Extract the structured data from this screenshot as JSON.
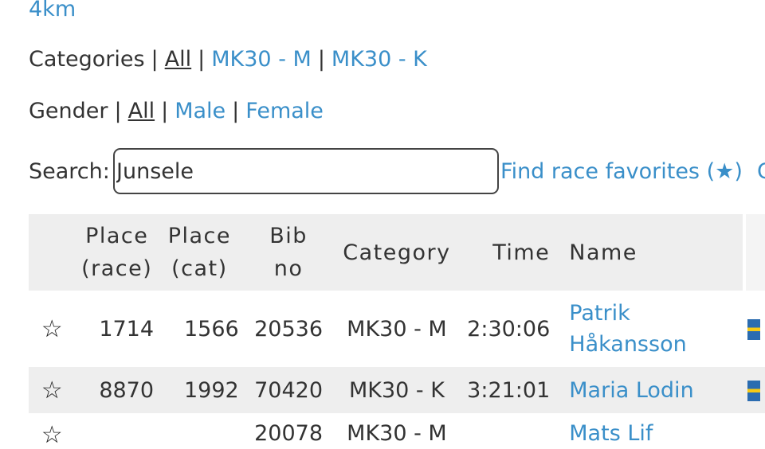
{
  "distance_label": "4km",
  "filters": {
    "categories": {
      "label": "Categories",
      "sep": "|",
      "options": [
        "All",
        "MK30 - M",
        "MK30 - K"
      ]
    },
    "gender": {
      "label": "Gender",
      "sep": "|",
      "options": [
        "All",
        "Male",
        "Female"
      ]
    }
  },
  "search": {
    "label": "Search:",
    "value": "Junsele",
    "favorites_link": "Find race favorites (★)",
    "next_link_partial": "C"
  },
  "table": {
    "columns": [
      "",
      "Place (race)",
      "Place (cat)",
      "Bib no",
      "Category",
      "Time",
      "Name",
      ""
    ],
    "header_lines": {
      "place_race": [
        "Place",
        "(race)"
      ],
      "place_cat": [
        "Place",
        "(cat)"
      ],
      "bib": [
        "Bib",
        "no"
      ],
      "category": "Category",
      "time": "Time",
      "name": "Name"
    },
    "rows": [
      {
        "star": "☆",
        "place_race": "1714",
        "place_cat": "1566",
        "bib": "20536",
        "category": "MK30 - M",
        "time": "2:30:06",
        "name": "Patrik Håkansson",
        "flag": "swedish-flag-icon"
      },
      {
        "star": "☆",
        "place_race": "8870",
        "place_cat": "1992",
        "bib": "70420",
        "category": "MK30 - K",
        "time": "3:21:01",
        "name": "Maria Lodin",
        "flag": "swedish-flag-icon"
      },
      {
        "star": "☆",
        "place_race": "",
        "place_cat": "",
        "bib": "20078",
        "category": "MK30 - M",
        "time": "",
        "name": "Mats Lif",
        "flag": "swedish-flag-icon"
      }
    ]
  },
  "colors": {
    "link": "#3a8fc9",
    "text": "#333333",
    "header_bg": "#eeeeee",
    "alt_row_bg": "#eeeeee"
  }
}
